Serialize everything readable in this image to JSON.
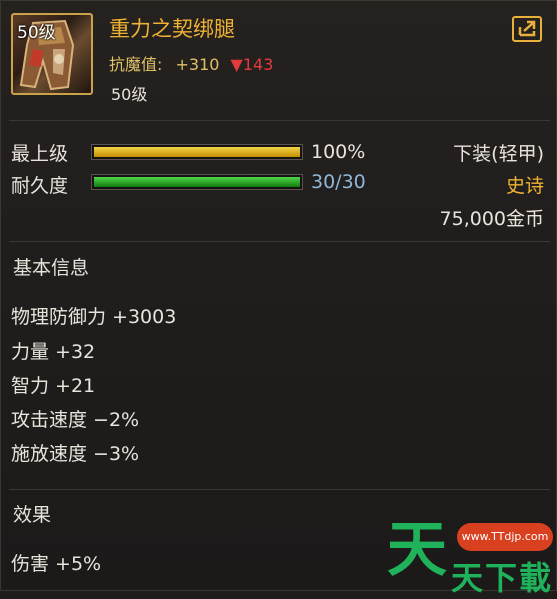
{
  "item": {
    "icon_level_label": "50级",
    "name": "重力之契绑腿",
    "stat_label": "抗魔值:",
    "stat_bonus": "+310",
    "stat_down_arrow": "▼",
    "stat_down_value": "143",
    "required_level": "50级"
  },
  "bars": {
    "max_level": {
      "label": "最上级",
      "text": "100%",
      "percent": 100
    },
    "durability": {
      "label": "耐久度",
      "text": "30/30",
      "percent": 100
    }
  },
  "info": {
    "slot": "下装(轻甲)",
    "rarity": "史诗",
    "price": "75,000金币"
  },
  "basic_info": {
    "title": "基本信息",
    "attributes": [
      "物理防御力 +3003",
      "力量 +32",
      "智力 +21",
      "攻击速度 −2%",
      "施放速度 −3%"
    ]
  },
  "effect": {
    "title": "效果",
    "lines": [
      "伤害 +5%"
    ]
  },
  "watermark": {
    "big": "天",
    "small": "天下載",
    "url": "www.TTdjp.com"
  },
  "colors": {
    "name": "#f0b232",
    "gold_bar": "#e6b800",
    "green_bar": "#22b41e",
    "rarity": "#f0b232",
    "durability_text": "#8fb7d8"
  },
  "icons": [
    "armor-leg-icon",
    "share-icon"
  ]
}
